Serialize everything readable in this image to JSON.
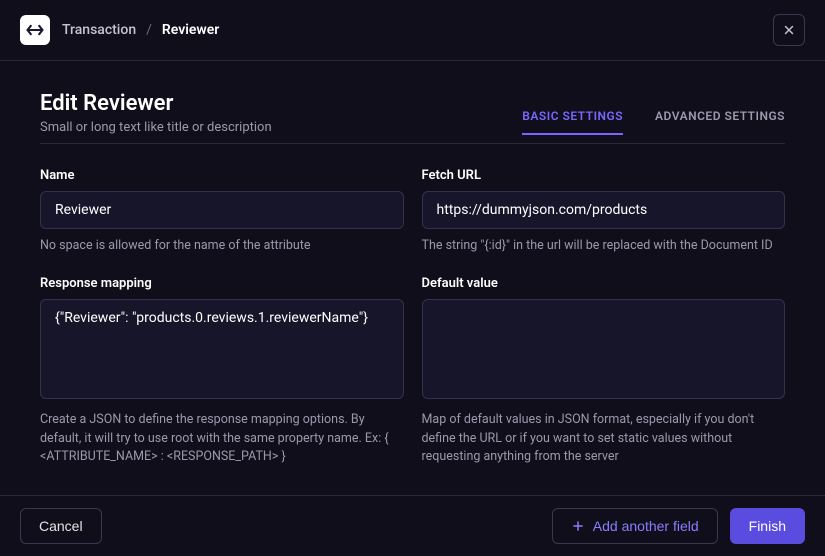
{
  "breadcrumb": {
    "item1": "Transaction",
    "separator": "/",
    "item2": "Reviewer"
  },
  "title": {
    "heading": "Edit Reviewer",
    "description": "Small or long text like title or description"
  },
  "tabs": {
    "basic": "BASIC SETTINGS",
    "advanced": "ADVANCED SETTINGS"
  },
  "fields": {
    "name": {
      "label": "Name",
      "value": "Reviewer",
      "help": "No space is allowed for the name of the attribute"
    },
    "fetchUrl": {
      "label": "Fetch URL",
      "value": "https://dummyjson.com/products",
      "help": "The string \"{:id}\" in the url will be replaced with the Document ID"
    },
    "responseMapping": {
      "label": "Response mapping",
      "value": "{\"Reviewer\": \"products.0.reviews.1.reviewerName\"}",
      "help": "Create a JSON to define the response mapping options. By default, it will try to use root with the same property name. Ex: { <ATTRIBUTE_NAME> : <RESPONSE_PATH> }"
    },
    "defaultValue": {
      "label": "Default value",
      "value": "",
      "help": "Map of default values in JSON format, especially if you don't define the URL or if you want to set static values without requesting anything from the server"
    }
  },
  "buttons": {
    "cancel": "Cancel",
    "addAnother": "Add another field",
    "finish": "Finish"
  }
}
